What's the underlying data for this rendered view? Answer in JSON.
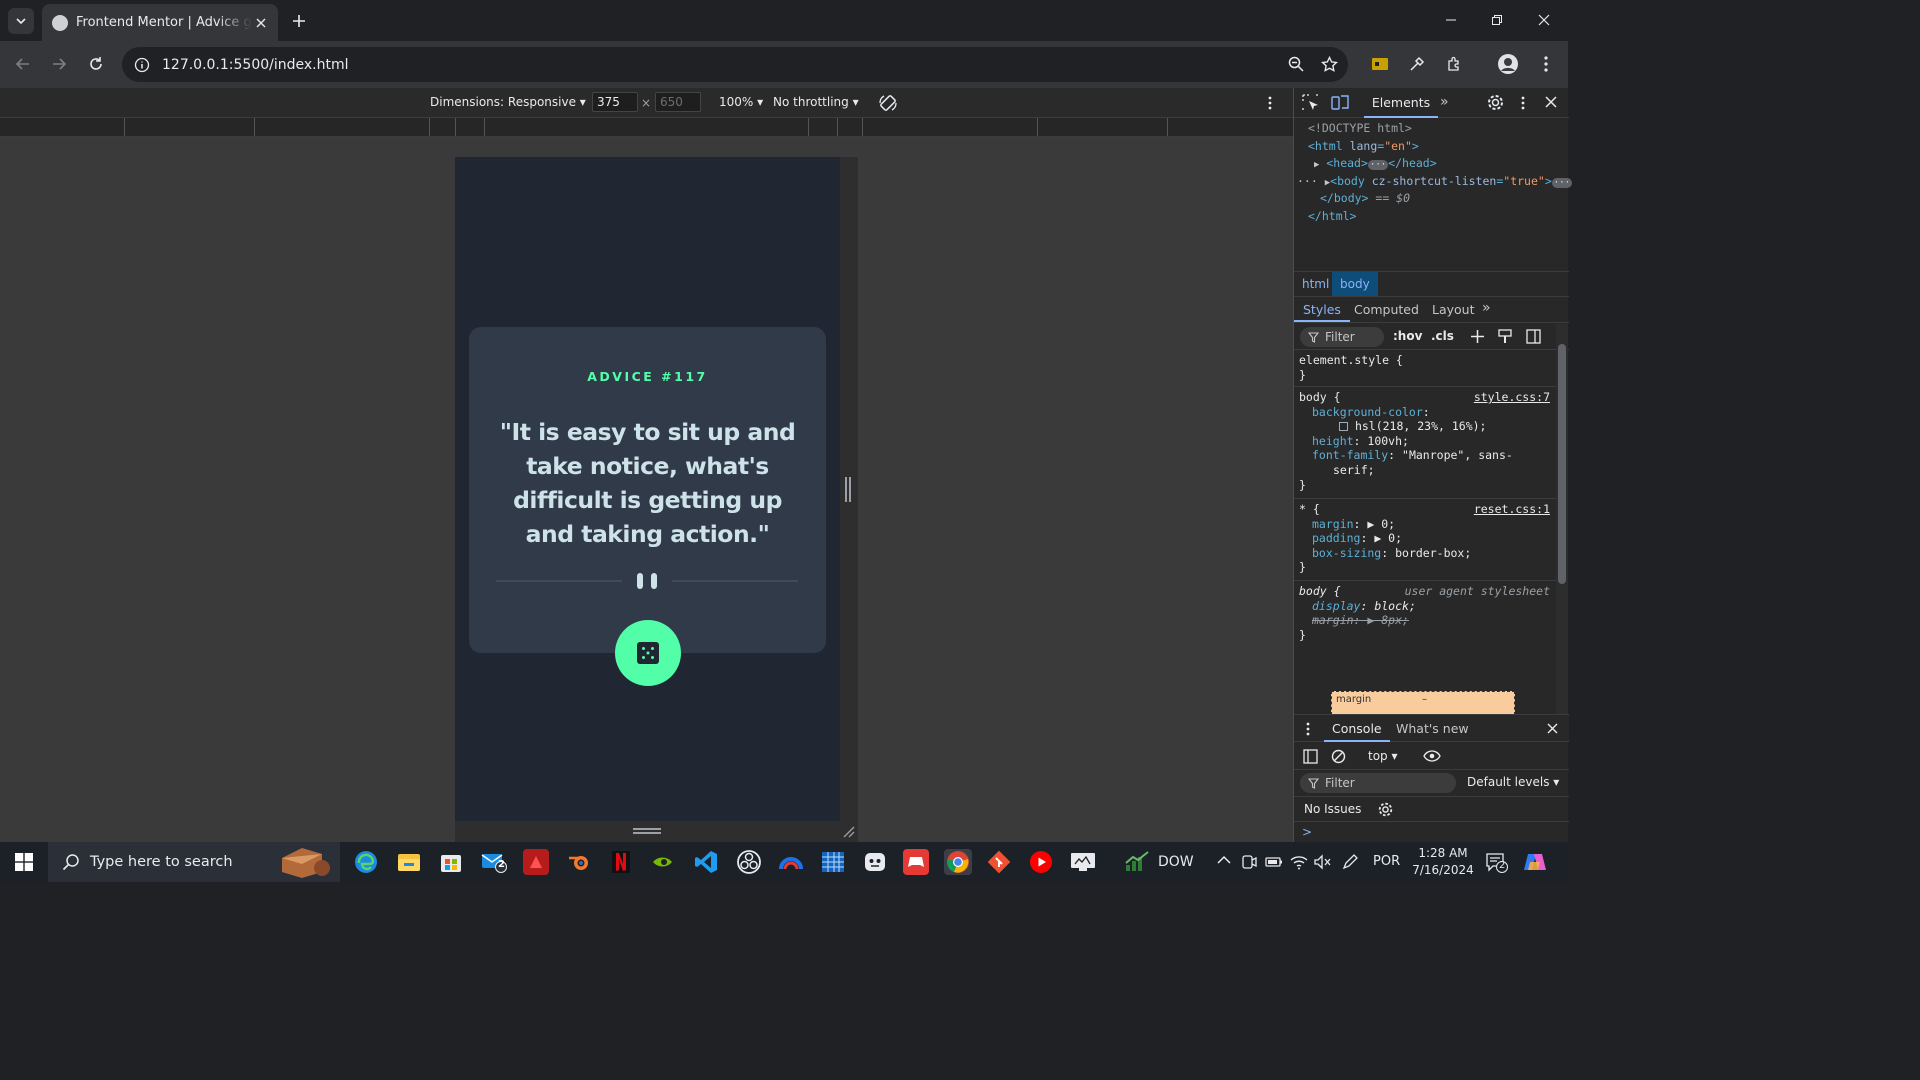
{
  "browser": {
    "tab_title": "Frontend Mentor | Advice generator app",
    "url": "127.0.0.1:5500/index.html"
  },
  "device_toolbar": {
    "dimensions_label": "Dimensions: Responsive",
    "width_value": "375",
    "height_placeholder": "650",
    "times_sign": "×",
    "zoom": "100%",
    "throttling": "No throttling"
  },
  "app": {
    "advice_number": "ADVICE #117",
    "advice_quote": "\"It is easy to sit up and take notice, what's difficult is getting up and taking action.\"",
    "colors": {
      "page_bg": "#202632",
      "card_bg": "#313a48",
      "accent": "#52ffa8",
      "quote_text": "#cee3e9"
    }
  },
  "devtools": {
    "tabs": {
      "elements": "Elements",
      "more": "»"
    },
    "dom": {
      "doctype": "<!DOCTYPE html>",
      "html_open_tag": "<html",
      "lang_attr": "lang",
      "lang_val": "\"en\"",
      "gt": ">",
      "head": "<head>",
      "head_close": "</head>",
      "ellipsis": "···",
      "body_open": "<body",
      "body_attr": "cz-shortcut-listen",
      "body_attr_val": "\"true\"",
      "body_close": "</body>",
      "sel_marker": "== $0",
      "html_close": "</html>"
    },
    "breadcrumbs": {
      "html": "html",
      "body": "body"
    },
    "styles_tabs": [
      "Styles",
      "Computed",
      "Layout"
    ],
    "styles_filter": "Filter",
    "hov": ":hov",
    "cls": ".cls",
    "rules": {
      "element_style_selector": "element.style {",
      "close_brace": "}",
      "body_selector": "body {",
      "body_source": "style.css:7",
      "bg_prop": "background-color",
      "bg_val": "hsl(218, 23%, 16%);",
      "height_prop": "height",
      "height_val": "100vh;",
      "font_prop": "font-family",
      "font_val": "\"Manrope\", sans-",
      "font_val_cont": "serif;",
      "reset_selector": "* {",
      "reset_source": "reset.css:1",
      "margin_prop": "margin",
      "margin_val": "▶ 0;",
      "padding_prop": "padding",
      "padding_val": "▶ 0;",
      "boxsizing_prop": "box-sizing",
      "boxsizing_val": "border-box;",
      "ua_selector": "body {",
      "ua_source": "user agent stylesheet",
      "display_prop": "display",
      "display_val": "block;",
      "ua_margin_prop": "margin",
      "ua_margin_val": "▶ 8px;"
    },
    "box_model_label": "margin",
    "box_model_value": "–",
    "console": {
      "tab": "Console",
      "whats_new": "What's new",
      "context": "top",
      "filter": "Filter",
      "levels": "Default levels",
      "issues": "No Issues",
      "prompt": ">"
    }
  },
  "taskbar": {
    "search_placeholder": "Type here to search",
    "mail_badge": "2",
    "stock_label": "DOW",
    "language": "POR",
    "time": "1:28 AM",
    "date": "7/16/2024",
    "notification_count": "2"
  }
}
